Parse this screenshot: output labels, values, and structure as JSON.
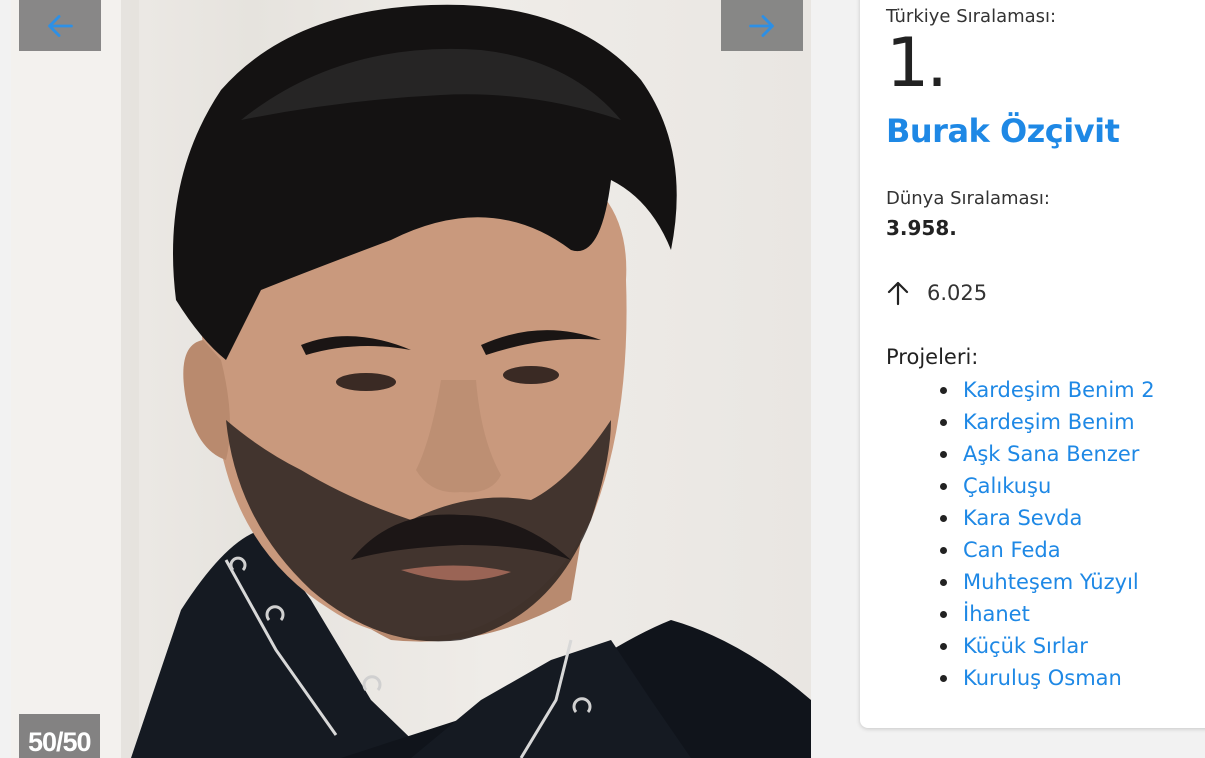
{
  "carousel": {
    "prev_icon": "arrow-left-icon",
    "next_icon": "arrow-right-icon",
    "counter": "50/50",
    "arrow_color": "#1e88e5"
  },
  "info": {
    "turkiye_label": "Türkiye Sıralaması:",
    "turkiye_rank": "1.",
    "name": "Burak Özçivit",
    "dunya_label": "Dünya Sıralaması:",
    "dunya_rank": "3.958.",
    "trend_icon": "arrow-up-icon",
    "trend_value": "6.025",
    "projects_label": "Projeleri:",
    "projects": [
      "Kardeşim Benim 2",
      "Kardeşim Benim",
      "Aşk Sana Benzer",
      "Çalıkuşu",
      "Kara Sevda",
      "Can Feda",
      "Muhteşem Yüzyıl",
      "İhanet",
      "Küçük Sırlar",
      "Kuruluş Osman"
    ]
  },
  "colors": {
    "link": "#1e88e5",
    "text": "#222222"
  }
}
